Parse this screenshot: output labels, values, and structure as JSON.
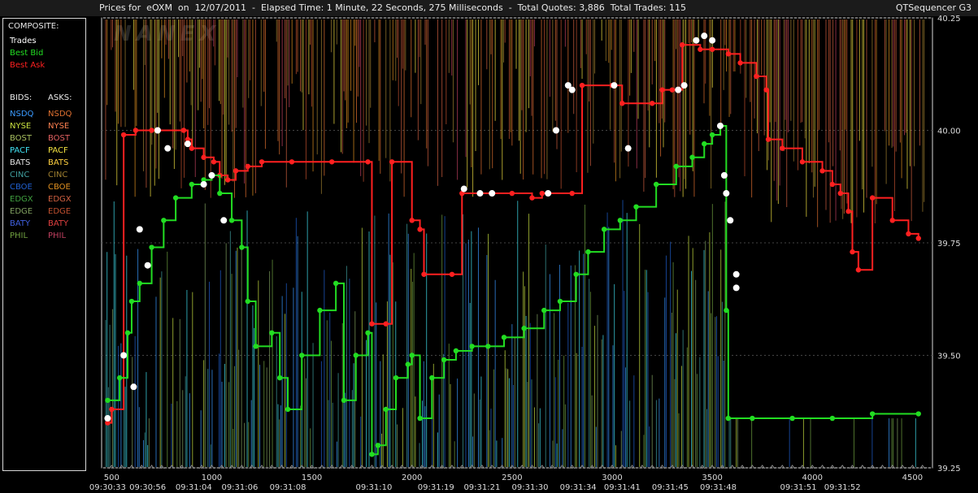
{
  "header": {
    "title": "Prices for  eOXM  on  12/07/2011  -  Elapsed Time: 1 Minute, 22 Seconds, 275 Milliseconds  -  Total Quotes: 3,886  Total Trades: 115",
    "app_name": "QTSequencer G3"
  },
  "legend": {
    "composite_title": "COMPOSITE:",
    "composite": [
      {
        "label": "Trades",
        "color": "#ffffff"
      },
      {
        "label": "Best Bid",
        "color": "#22dd22"
      },
      {
        "label": "Best Ask",
        "color": "#ff2020"
      }
    ],
    "bids_title": "BIDS:",
    "asks_title": "ASKS:",
    "bids": [
      {
        "label": "NSDQ",
        "color": "#3a9aff"
      },
      {
        "label": "NYSE",
        "color": "#c8e040"
      },
      {
        "label": "BOST",
        "color": "#a8c060"
      },
      {
        "label": "PACF",
        "color": "#40e0f0"
      },
      {
        "label": "BATS",
        "color": "#e0e0e0"
      },
      {
        "label": "CINC",
        "color": "#40a0a0"
      },
      {
        "label": "CBOE",
        "color": "#2060d0"
      },
      {
        "label": "EDGX",
        "color": "#40a040"
      },
      {
        "label": "EDGE",
        "color": "#80a060"
      },
      {
        "label": "BATY",
        "color": "#4060e0"
      },
      {
        "label": "PHIL",
        "color": "#70a040"
      }
    ],
    "asks": [
      {
        "label": "NSDQ",
        "color": "#e07030"
      },
      {
        "label": "NYSE",
        "color": "#ff8050"
      },
      {
        "label": "BOST",
        "color": "#e06060"
      },
      {
        "label": "PACF",
        "color": "#f0e040"
      },
      {
        "label": "BATS",
        "color": "#ffd040"
      },
      {
        "label": "CINC",
        "color": "#a08030"
      },
      {
        "label": "CBOE",
        "color": "#e09020"
      },
      {
        "label": "EDGX",
        "color": "#d06040"
      },
      {
        "label": "EDGE",
        "color": "#c05030"
      },
      {
        "label": "BATY",
        "color": "#e04040"
      },
      {
        "label": "PHIL",
        "color": "#c04060"
      }
    ]
  },
  "chart_data": {
    "type": "line",
    "watermark": "NANEX",
    "y_ticks": [
      "40.25",
      "40.00",
      "39.75",
      "39.50",
      "39.25"
    ],
    "ylim": [
      39.25,
      40.25
    ],
    "xlim": [
      450,
      4600
    ],
    "x_ticks": [
      {
        "value": 500,
        "label": "500"
      },
      {
        "value": 1000,
        "label": "1000"
      },
      {
        "value": 1500,
        "label": "1500"
      },
      {
        "value": 2000,
        "label": "2000"
      },
      {
        "value": 2500,
        "label": "2500"
      },
      {
        "value": 3000,
        "label": "3000"
      },
      {
        "value": 3500,
        "label": "3500"
      },
      {
        "value": 4000,
        "label": "4000"
      },
      {
        "value": 4500,
        "label": "4500"
      }
    ],
    "time_labels": [
      {
        "value": 480,
        "label": "09:30:33"
      },
      {
        "value": 680,
        "label": "09:30:56"
      },
      {
        "value": 910,
        "label": "09:31:04"
      },
      {
        "value": 1140,
        "label": "09:31:06"
      },
      {
        "value": 1380,
        "label": "09:31:08"
      },
      {
        "value": 1810,
        "label": "09:31:10"
      },
      {
        "value": 2120,
        "label": "09:31:19"
      },
      {
        "value": 2350,
        "label": "09:31:21"
      },
      {
        "value": 2590,
        "label": "09:31:30"
      },
      {
        "value": 2830,
        "label": "09:31:34"
      },
      {
        "value": 3050,
        "label": "09:31:41"
      },
      {
        "value": 3290,
        "label": "09:31:45"
      },
      {
        "value": 3530,
        "label": "09:31:48"
      },
      {
        "value": 3930,
        "label": "09:31:51"
      },
      {
        "value": 4150,
        "label": "09:31:52"
      }
    ],
    "series": [
      {
        "name": "Best Ask",
        "color": "#ff2020",
        "points": [
          [
            480,
            39.35
          ],
          [
            500,
            39.38
          ],
          [
            560,
            39.99
          ],
          [
            620,
            40.0
          ],
          [
            700,
            40.0
          ],
          [
            860,
            40.0
          ],
          [
            880,
            39.98
          ],
          [
            900,
            39.96
          ],
          [
            960,
            39.94
          ],
          [
            1010,
            39.93
          ],
          [
            1040,
            39.9
          ],
          [
            1080,
            39.89
          ],
          [
            1120,
            39.91
          ],
          [
            1180,
            39.92
          ],
          [
            1250,
            39.93
          ],
          [
            1400,
            39.93
          ],
          [
            1600,
            39.93
          ],
          [
            1780,
            39.93
          ],
          [
            1800,
            39.57
          ],
          [
            1870,
            39.57
          ],
          [
            1900,
            39.93
          ],
          [
            2000,
            39.8
          ],
          [
            2040,
            39.78
          ],
          [
            2060,
            39.68
          ],
          [
            2200,
            39.68
          ],
          [
            2250,
            39.86
          ],
          [
            2500,
            39.86
          ],
          [
            2600,
            39.85
          ],
          [
            2650,
            39.86
          ],
          [
            2800,
            39.86
          ],
          [
            2850,
            40.1
          ],
          [
            3000,
            40.1
          ],
          [
            3050,
            40.06
          ],
          [
            3200,
            40.06
          ],
          [
            3250,
            40.09
          ],
          [
            3300,
            40.09
          ],
          [
            3350,
            40.19
          ],
          [
            3440,
            40.18
          ],
          [
            3500,
            40.18
          ],
          [
            3580,
            40.17
          ],
          [
            3640,
            40.15
          ],
          [
            3720,
            40.12
          ],
          [
            3770,
            40.09
          ],
          [
            3780,
            39.98
          ],
          [
            3850,
            39.96
          ],
          [
            3950,
            39.93
          ],
          [
            4050,
            39.91
          ],
          [
            4100,
            39.88
          ],
          [
            4140,
            39.86
          ],
          [
            4180,
            39.82
          ],
          [
            4200,
            39.73
          ],
          [
            4230,
            39.69
          ],
          [
            4300,
            39.85
          ],
          [
            4400,
            39.8
          ],
          [
            4480,
            39.77
          ],
          [
            4530,
            39.76
          ]
        ]
      },
      {
        "name": "Best Bid",
        "color": "#22dd22",
        "points": [
          [
            480,
            39.4
          ],
          [
            540,
            39.45
          ],
          [
            580,
            39.55
          ],
          [
            600,
            39.62
          ],
          [
            640,
            39.66
          ],
          [
            700,
            39.74
          ],
          [
            760,
            39.8
          ],
          [
            820,
            39.85
          ],
          [
            900,
            39.88
          ],
          [
            960,
            39.89
          ],
          [
            1000,
            39.9
          ],
          [
            1040,
            39.86
          ],
          [
            1100,
            39.8
          ],
          [
            1150,
            39.74
          ],
          [
            1180,
            39.62
          ],
          [
            1220,
            39.52
          ],
          [
            1300,
            39.55
          ],
          [
            1340,
            39.45
          ],
          [
            1380,
            39.38
          ],
          [
            1450,
            39.5
          ],
          [
            1540,
            39.6
          ],
          [
            1620,
            39.66
          ],
          [
            1660,
            39.4
          ],
          [
            1720,
            39.5
          ],
          [
            1780,
            39.55
          ],
          [
            1800,
            39.28
          ],
          [
            1830,
            39.3
          ],
          [
            1870,
            39.38
          ],
          [
            1920,
            39.45
          ],
          [
            1980,
            39.48
          ],
          [
            2000,
            39.5
          ],
          [
            2040,
            39.36
          ],
          [
            2100,
            39.45
          ],
          [
            2160,
            39.49
          ],
          [
            2220,
            39.51
          ],
          [
            2300,
            39.52
          ],
          [
            2380,
            39.52
          ],
          [
            2460,
            39.54
          ],
          [
            2560,
            39.56
          ],
          [
            2660,
            39.6
          ],
          [
            2740,
            39.62
          ],
          [
            2820,
            39.68
          ],
          [
            2880,
            39.73
          ],
          [
            2960,
            39.78
          ],
          [
            3040,
            39.8
          ],
          [
            3120,
            39.83
          ],
          [
            3220,
            39.88
          ],
          [
            3320,
            39.92
          ],
          [
            3400,
            39.94
          ],
          [
            3460,
            39.97
          ],
          [
            3500,
            39.99
          ],
          [
            3540,
            40.01
          ],
          [
            3570,
            39.6
          ],
          [
            3580,
            39.36
          ],
          [
            3700,
            39.36
          ],
          [
            3900,
            39.36
          ],
          [
            4100,
            39.36
          ],
          [
            4300,
            39.37
          ],
          [
            4530,
            39.37
          ]
        ]
      },
      {
        "name": "Trades",
        "color": "#ffffff",
        "points": [
          [
            480,
            39.36
          ],
          [
            560,
            39.5
          ],
          [
            610,
            39.43
          ],
          [
            640,
            39.78
          ],
          [
            680,
            39.7
          ],
          [
            730,
            40.0
          ],
          [
            780,
            39.96
          ],
          [
            880,
            39.97
          ],
          [
            960,
            39.88
          ],
          [
            1000,
            39.9
          ],
          [
            1060,
            39.8
          ],
          [
            2260,
            39.87
          ],
          [
            2340,
            39.86
          ],
          [
            2400,
            39.86
          ],
          [
            2680,
            39.86
          ],
          [
            2720,
            40.0
          ],
          [
            2780,
            40.1
          ],
          [
            2800,
            40.09
          ],
          [
            3010,
            40.1
          ],
          [
            3080,
            39.96
          ],
          [
            3330,
            40.09
          ],
          [
            3360,
            40.1
          ],
          [
            3420,
            40.2
          ],
          [
            3460,
            40.21
          ],
          [
            3500,
            40.2
          ],
          [
            3540,
            40.01
          ],
          [
            3560,
            39.9
          ],
          [
            3570,
            39.86
          ],
          [
            3590,
            39.8
          ],
          [
            3620,
            39.68
          ],
          [
            3620,
            39.65
          ]
        ]
      }
    ]
  }
}
